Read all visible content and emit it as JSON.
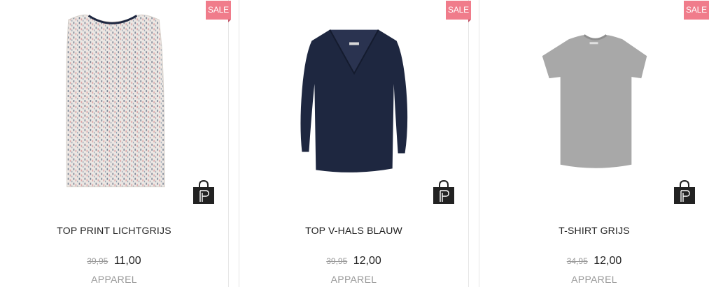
{
  "products": [
    {
      "badge": "SALE",
      "title": "TOP PRINT LICHTGRIJS",
      "old_price": "39,95",
      "price": "11,00",
      "category": "APPAREL",
      "icon": "shopping-bag-icon"
    },
    {
      "badge": "SALE",
      "title": "TOP V-HALS BLAUW",
      "old_price": "39,95",
      "price": "12,00",
      "category": "APPAREL",
      "icon": "shopping-bag-icon"
    },
    {
      "badge": "SALE",
      "title": "T-SHIRT GRIJS",
      "old_price": "34,95",
      "price": "12,00",
      "category": "APPAREL",
      "icon": "shopping-bag-icon"
    }
  ],
  "colors": {
    "sale_badge": "#f07c8b",
    "price_muted": "#9a9a9a",
    "navy_top": "#1e2740",
    "grey_tshirt": "#a8a8a8",
    "print_top": "#e8e2de"
  }
}
